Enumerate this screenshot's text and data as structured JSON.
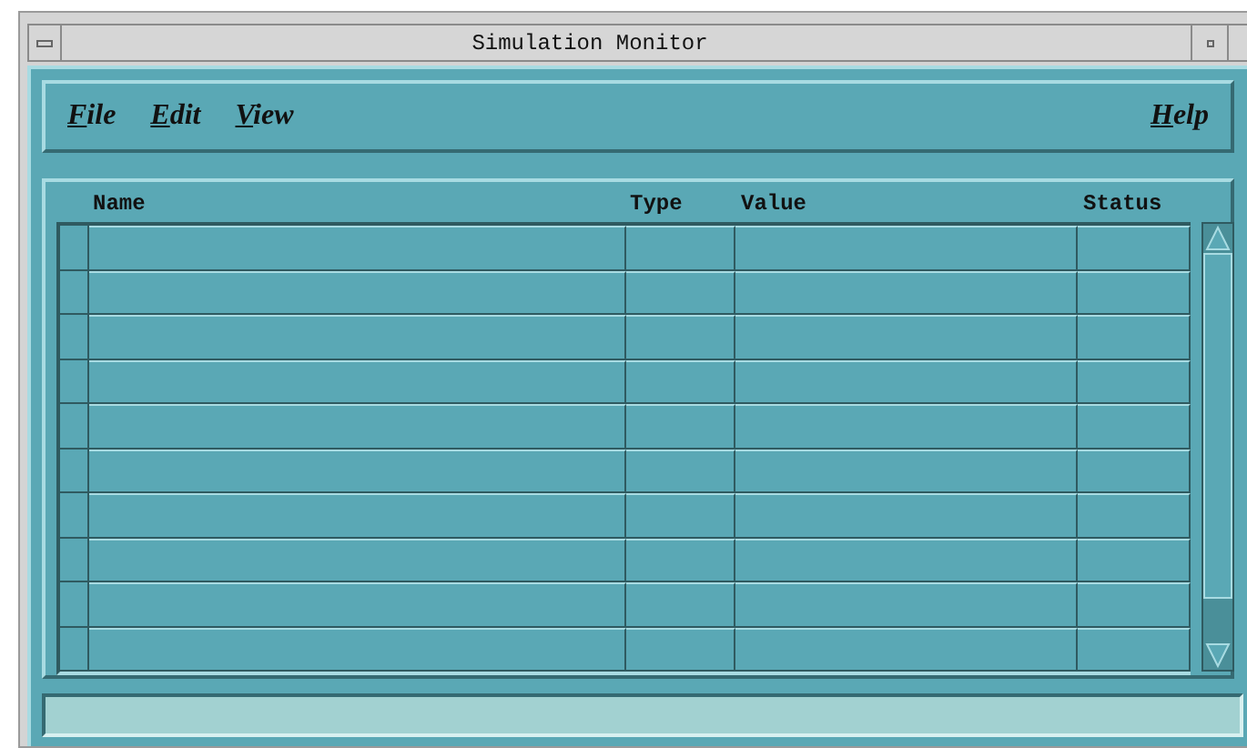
{
  "window": {
    "title": "Simulation Monitor"
  },
  "menu": {
    "left": [
      {
        "label": "File"
      },
      {
        "label": "Edit"
      },
      {
        "label": "View"
      }
    ],
    "right": [
      {
        "label": "Help"
      }
    ]
  },
  "table": {
    "columns": [
      "Name",
      "Type",
      "Value",
      "Status"
    ]
  }
}
